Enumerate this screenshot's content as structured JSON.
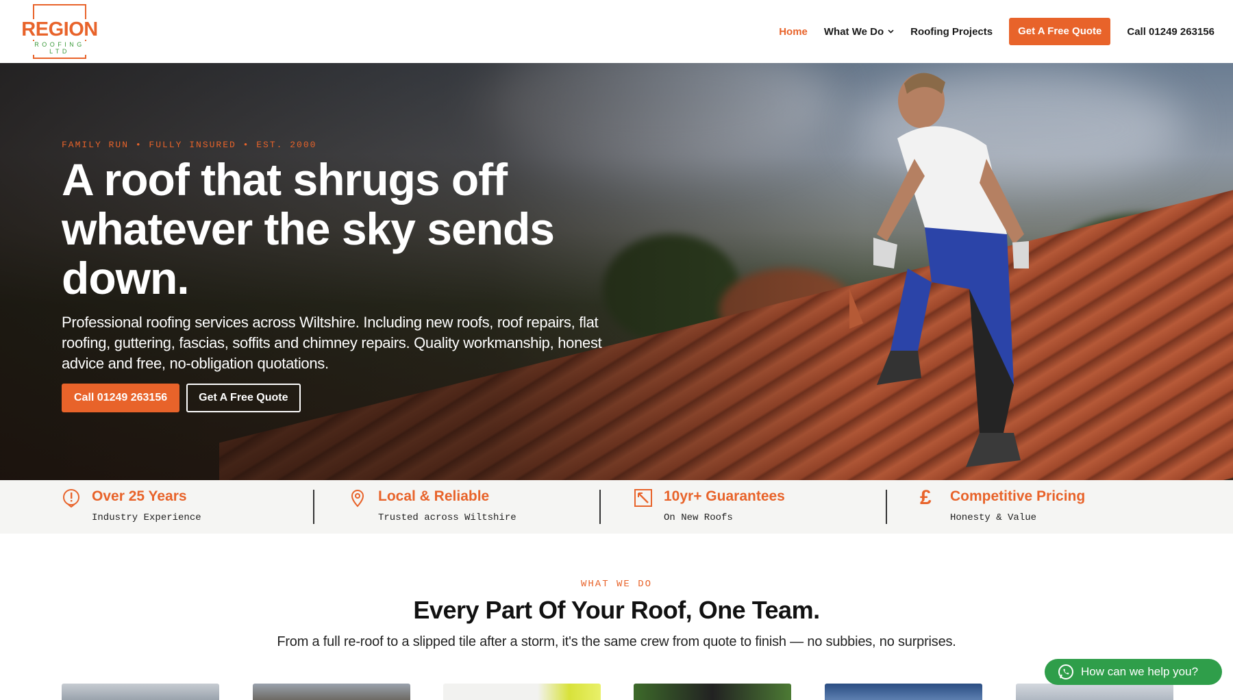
{
  "brand": {
    "logo_word": "REGION",
    "logo_sub": "ROOFING LTD",
    "accent_color": "#e8632a",
    "logo_sub_color": "#3a9a3a"
  },
  "nav": {
    "home": "Home",
    "what_we_do": "What We Do",
    "roofing_projects": "Roofing Projects",
    "quote_button": "Get A Free Quote",
    "phone": "Call 01249 263156"
  },
  "hero": {
    "eyebrow": "FAMILY RUN • FULLY INSURED • EST. 2000",
    "headline": "A roof that shrugs off whatever the sky sends down.",
    "subtext": "Professional roofing services across Wiltshire. Including new roofs, roof repairs, flat roofing, guttering, fascias, soffits and chimney repairs. Quality workmanship, honest advice and free, no-obligation quotations.",
    "call_button": "Call 01249 263156",
    "quote_button": "Get A Free Quote"
  },
  "features": [
    {
      "icon": "alert-shield-icon",
      "title": "Over 25 Years",
      "subtitle": "Industry Experience"
    },
    {
      "icon": "location-pin-icon",
      "title": "Local & Reliable",
      "subtitle": "Trusted across Wiltshire"
    },
    {
      "icon": "guarantee-badge-icon",
      "title": "10yr+ Guarantees",
      "subtitle": "On New Roofs"
    },
    {
      "icon": "pound-sign-icon",
      "title": "Competitive Pricing",
      "subtitle": "Honesty & Value"
    }
  ],
  "services": {
    "eyebrow": "WHAT WE DO",
    "title": "Every Part Of Your Roof, One Team.",
    "subtitle": "From a full re-roof to a slipped tile after a storm, it's the same crew from quote to finish — no subbies, no surprises."
  },
  "whatsapp": {
    "label": "How can we help you?",
    "color": "#2f9e4a"
  }
}
